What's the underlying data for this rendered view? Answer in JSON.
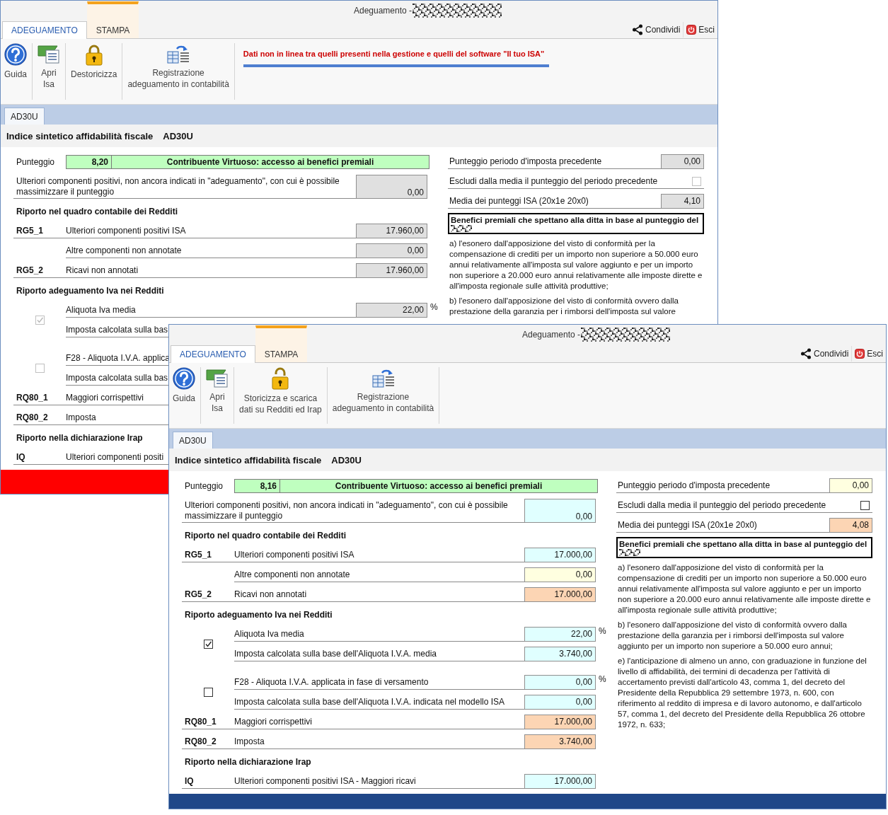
{
  "windows": [
    {
      "title": "Adeguamento -",
      "color": "#ff0000",
      "tabs": [
        {
          "label": "ADEGUAMENTO",
          "selected": true,
          "kind": "normal"
        },
        {
          "label": "STAMPA",
          "selected": false,
          "kind": "contextual"
        }
      ],
      "actions": [
        {
          "label": "Condividi",
          "kind": "share"
        },
        {
          "label": "Esci",
          "kind": "exit"
        }
      ],
      "toolbar": [
        {
          "label": "Guida",
          "kind": "help"
        },
        {
          "label": "Apri\nIsa",
          "kind": "open"
        },
        {
          "label": "Destoricizza",
          "kind": "lock"
        },
        {
          "label": "Registrazione\nadeguamento in contabilità",
          "kind": "register"
        }
      ],
      "alert": "Dati non in linea tra quelli presenti nella gestione e quelli del software \"Il tuo ISA\"",
      "doc_tabs": [
        {
          "label": "AD30U",
          "selected": true
        }
      ],
      "heading": {
        "title": "Indice sintetico affidabilità fiscale",
        "code": "AD30U"
      },
      "score": {
        "label": "Punteggio",
        "value": "8,20",
        "status": "Contribuente Virtuoso: accesso ai benefici premiali"
      },
      "left": [
        {
          "kind": "note",
          "label": "Ulteriori componenti positivi, non ancora indicati in \"adeguamento\", con cui è possibile massimizzare il punteggio",
          "value": "0,00",
          "color": "#e0e0e0"
        },
        {
          "kind": "heading",
          "label": "Riporto nel quadro contabile dei Redditi"
        },
        {
          "kind": "field",
          "code": "RG5_1",
          "label": "Ulteriori componenti positivi ISA",
          "value": "17.960,00",
          "color": "#e0e0e0"
        },
        {
          "kind": "field",
          "label": "Altre componenti non annotate",
          "value": "0,00",
          "color": "#e0e0e0"
        },
        {
          "kind": "field",
          "code": "RG5_2",
          "label": "Ricavi non annotati",
          "value": "17.960,00",
          "color": "#e0e0e0"
        },
        {
          "kind": "heading",
          "label": "Riporto adeguamento Iva nei Redditi"
        },
        {
          "kind": "check_group",
          "checked": true,
          "disabled": true,
          "rows": [
            {
              "label": "Aliquota Iva media",
              "value": "22,00",
              "color": "#e0e0e0",
              "unit": "%"
            },
            {
              "label": "Imposta calcolata sulla bas"
            }
          ]
        },
        {
          "kind": "check_group",
          "checked": false,
          "disabled": true,
          "rows": [
            {
              "label": "F28 - Aliquota I.V.A. applica"
            },
            {
              "label": "Imposta calcolata sulla bas"
            }
          ]
        },
        {
          "kind": "field",
          "code": "RQ80_1",
          "label": "Maggiori corrispettivi"
        },
        {
          "kind": "field",
          "code": "RQ80_2",
          "label": "Imposta"
        },
        {
          "kind": "heading",
          "label": "Riporto nella dichiarazione Irap"
        },
        {
          "kind": "field",
          "code": "IQ",
          "label": "Ulteriori componenti positi"
        }
      ],
      "right": [
        {
          "kind": "field",
          "label": "Punteggio periodo d'imposta precedente",
          "value": "0,00",
          "color": "#e0e0e0"
        },
        {
          "kind": "check",
          "label": "Escludi dalla media il punteggio del periodo precedente",
          "checked": false,
          "disabled": true
        },
        {
          "kind": "field",
          "label": "Media dei punteggi ISA (20x1e 20x0)",
          "value": "4,10",
          "color": "#e0e0e0"
        }
      ],
      "benefits": {
        "title": "Benefici premiali che spettano alla ditta in base al punteggio del",
        "items": [
          "a) l'esonero dall'apposizione del visto di conformità per la compensazione di crediti per un importo non superiore a 50.000 euro annui relativamente all'imposta sul valore aggiunto e per un importo non superiore a 20.000 euro annui relativamente alle imposte dirette e all'imposta regionale sulle attività produttive;",
          "b) l'esonero dall'apposizione del visto di conformità ovvero dalla prestazione della garanzia per i rimborsi dell'imposta sul valore"
        ]
      }
    },
    {
      "title": "Adeguamento -",
      "color": "#1f4788",
      "tabs": [
        {
          "label": "ADEGUAMENTO",
          "selected": true,
          "kind": "normal"
        },
        {
          "label": "STAMPA",
          "selected": false,
          "kind": "contextual"
        }
      ],
      "actions": [
        {
          "label": "Condividi",
          "kind": "share"
        },
        {
          "label": "Esci",
          "kind": "exit"
        }
      ],
      "toolbar": [
        {
          "label": "Guida",
          "kind": "help"
        },
        {
          "label": "Apri\nIsa",
          "kind": "open"
        },
        {
          "label": "Storicizza e scarica\ndati su Redditi ed Irap",
          "kind": "unlock"
        },
        {
          "label": "Registrazione\nadeguamento in contabilità",
          "kind": "register"
        }
      ],
      "doc_tabs": [
        {
          "label": "AD30U",
          "selected": true
        }
      ],
      "heading": {
        "title": "Indice sintetico affidabilità fiscale",
        "code": "AD30U"
      },
      "score": {
        "label": "Punteggio",
        "value": "8,16",
        "status": "Contribuente Virtuoso: accesso ai benefici premiali"
      },
      "left": [
        {
          "kind": "note",
          "label": "Ulteriori componenti positivi, non ancora indicati in \"adeguamento\", con cui è possibile massimizzare il punteggio",
          "value": "0,00",
          "color": "#e0ffff"
        },
        {
          "kind": "heading",
          "label": "Riporto nel quadro contabile dei Redditi"
        },
        {
          "kind": "field",
          "code": "RG5_1",
          "label": "Ulteriori componenti positivi ISA",
          "value": "17.000,00",
          "color": "#e0ffff"
        },
        {
          "kind": "field",
          "label": "Altre componenti non annotate",
          "value": "0,00",
          "color": "#ffffe0"
        },
        {
          "kind": "field",
          "code": "RG5_2",
          "label": "Ricavi non annotati",
          "value": "17.000,00",
          "color": "#fcd5b4"
        },
        {
          "kind": "heading",
          "label": "Riporto adeguamento Iva nei Redditi"
        },
        {
          "kind": "check_group",
          "checked": true,
          "disabled": false,
          "rows": [
            {
              "label": "Aliquota Iva media",
              "value": "22,00",
              "color": "#e0ffff",
              "unit": "%"
            },
            {
              "label": "Imposta calcolata sulla base dell'Aliquota I.V.A. media",
              "value": "3.740,00",
              "color": "#e0ffff"
            }
          ]
        },
        {
          "kind": "check_group",
          "checked": false,
          "disabled": false,
          "rows": [
            {
              "label": "F28 - Aliquota I.V.A. applicata in fase di versamento",
              "value": "0,00",
              "color": "#e0ffff",
              "unit": "%"
            },
            {
              "label": "Imposta calcolata sulla base dell'Aliquota I.V.A. indicata nel modello ISA",
              "value": "0,00",
              "color": "#e0ffff"
            }
          ]
        },
        {
          "kind": "field",
          "code": "RQ80_1",
          "label": "Maggiori corrispettivi",
          "value": "17.000,00",
          "color": "#fcd5b4"
        },
        {
          "kind": "field",
          "code": "RQ80_2",
          "label": "Imposta",
          "value": "3.740,00",
          "color": "#fcd5b4"
        },
        {
          "kind": "heading",
          "label": "Riporto nella dichiarazione Irap"
        },
        {
          "kind": "field",
          "code": "IQ",
          "label": "Ulteriori componenti positivi ISA - Maggiori ricavi",
          "value": "17.000,00",
          "color": "#e0ffff"
        }
      ],
      "right": [
        {
          "kind": "field",
          "label": "Punteggio periodo d'imposta precedente",
          "value": "0,00",
          "color": "#ffffe0"
        },
        {
          "kind": "check",
          "label": "Escludi dalla media il punteggio del periodo precedente",
          "checked": false,
          "disabled": false
        },
        {
          "kind": "field",
          "label": "Media dei punteggi ISA (20x1e 20x0)",
          "value": "4,08",
          "color": "#fcd5b4"
        }
      ],
      "benefits": {
        "title": "Benefici premiali che spettano alla ditta in base al punteggio del",
        "items": [
          "a) l'esonero dall'apposizione del visto di conformità per la compensazione di crediti per un importo non superiore a 50.000 euro annui relativamente all'imposta sul valore aggiunto e per un importo non superiore a 20.000 euro annui relativamente alle imposte dirette e all'imposta regionale sulle attività produttive;",
          "b) l'esonero dall'apposizione del visto di conformità ovvero dalla prestazione della garanzia per i rimborsi dell'imposta sul valore aggiunto per un importo non superiore a 50.000 euro annui;",
          "e) l'anticipazione di almeno un anno, con graduazione in funzione del livello di affidabilità, dei termini di decadenza per l'attività di accertamento previsti dall'articolo 43, comma 1, del decreto del Presidente della Repubblica 29 settembre 1973, n. 600, con riferimento al reddito di impresa e di lavoro autonomo, e dall'articolo 57, comma 1, del decreto del Presidente della Repubblica 26 ottobre 1972, n. 633;"
        ]
      }
    }
  ]
}
